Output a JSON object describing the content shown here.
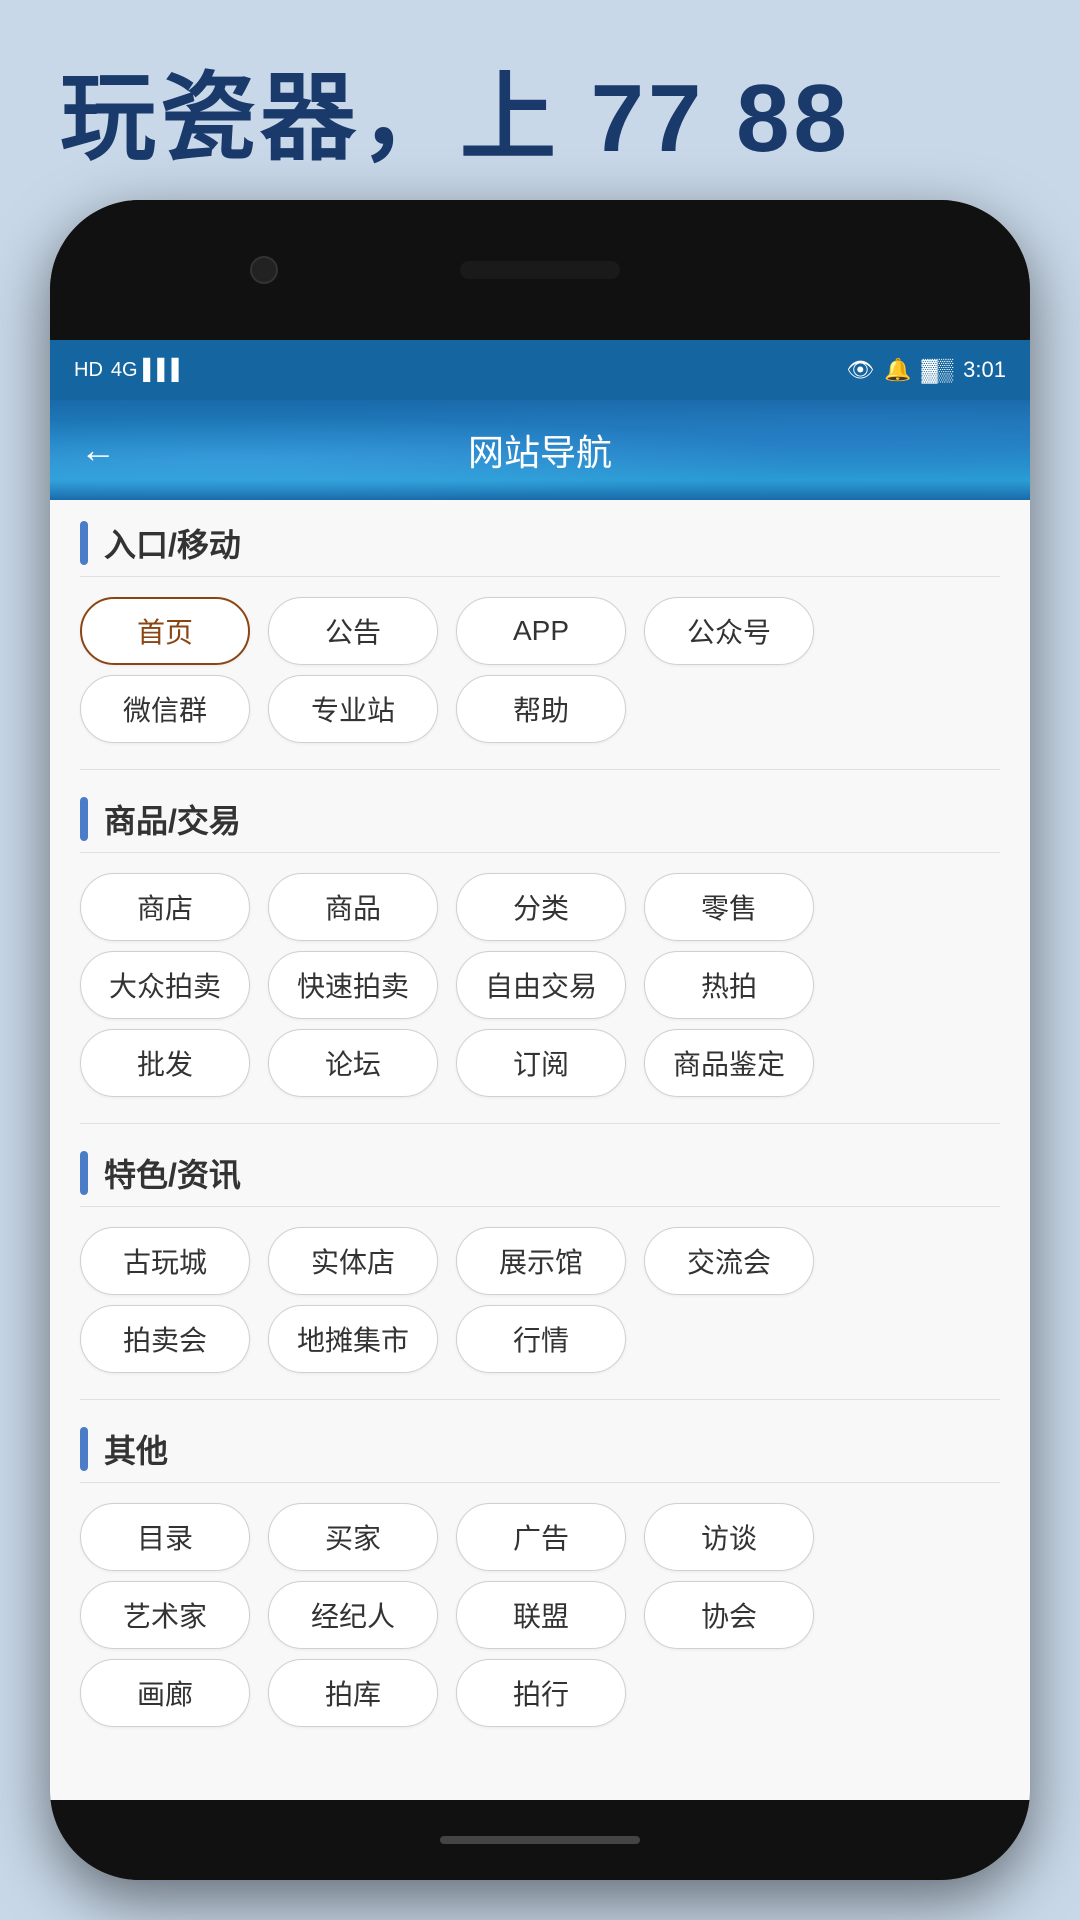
{
  "tagline": "玩瓷器，上 77 88",
  "statusBar": {
    "left": "HD 4G",
    "right": "3:01"
  },
  "header": {
    "title": "网站导航",
    "backLabel": "←"
  },
  "sections": [
    {
      "id": "entrance",
      "title": "入口/移动",
      "rows": [
        [
          "首页",
          "公告",
          "APP",
          "公众号"
        ],
        [
          "微信群",
          "专业站",
          "帮助"
        ]
      ],
      "activeBtn": "首页"
    },
    {
      "id": "trade",
      "title": "商品/交易",
      "rows": [
        [
          "商店",
          "商品",
          "分类",
          "零售"
        ],
        [
          "大众拍卖",
          "快速拍卖",
          "自由交易",
          "热拍"
        ],
        [
          "批发",
          "论坛",
          "订阅",
          "商品鉴定"
        ]
      ],
      "activeBtn": null
    },
    {
      "id": "featured",
      "title": "特色/资讯",
      "rows": [
        [
          "古玩城",
          "实体店",
          "展示馆",
          "交流会"
        ],
        [
          "拍卖会",
          "地摊集市",
          "行情"
        ]
      ],
      "activeBtn": null
    },
    {
      "id": "other",
      "title": "其他",
      "rows": [
        [
          "目录",
          "买家",
          "广告",
          "访谈"
        ],
        [
          "艺术家",
          "经纪人",
          "联盟",
          "协会"
        ],
        [
          "画廊",
          "拍库",
          "拍行"
        ]
      ],
      "activeBtn": null
    }
  ]
}
